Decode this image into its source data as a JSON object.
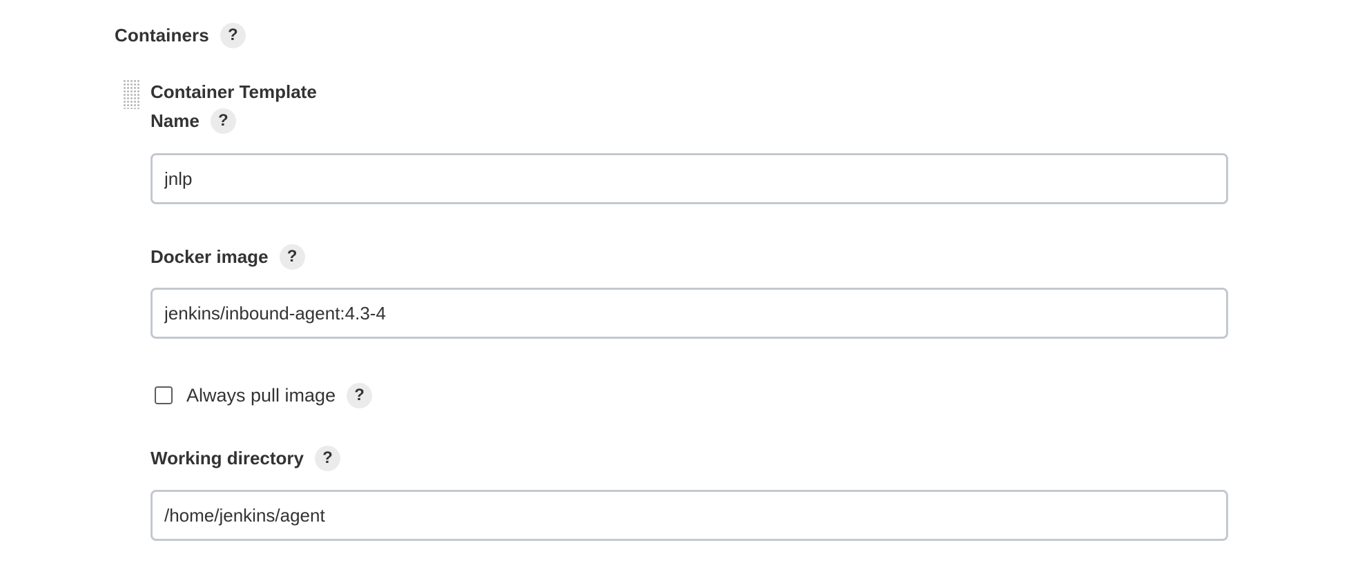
{
  "containers_section": {
    "title": "Containers",
    "help": "?"
  },
  "container_template": {
    "title": "Container Template",
    "name": {
      "label": "Name",
      "help": "?",
      "value": "jnlp"
    },
    "docker_image": {
      "label": "Docker image",
      "help": "?",
      "value": "jenkins/inbound-agent:4.3-4"
    },
    "always_pull_image": {
      "label": "Always pull image",
      "help": "?",
      "checked": false
    },
    "working_directory": {
      "label": "Working directory",
      "help": "?",
      "value": "/home/jenkins/agent"
    }
  },
  "icons": {
    "help": "question-mark-icon",
    "drag_handle": "drag-handle-icon"
  }
}
